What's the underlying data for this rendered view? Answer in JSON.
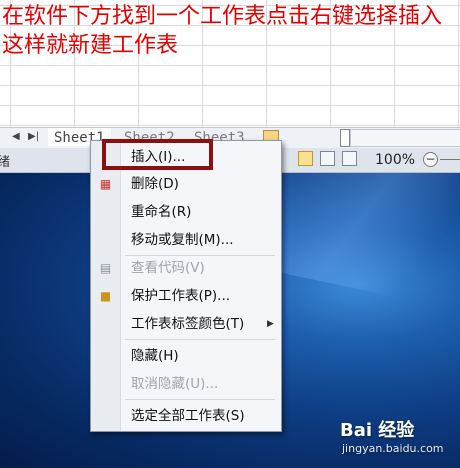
{
  "instruction": {
    "text": "在软件下方找到一个工作表点击右键选择插入这样就新建工作表",
    "color": "#e60000"
  },
  "sheet_tabs": {
    "first_nav_label": "◀",
    "last_nav_label": "▶|",
    "tabs": [
      "Sheet1",
      "Sheet2",
      "Sheet3"
    ],
    "new_sheet_icon": "new-sheet-icon"
  },
  "status_bar": {
    "ready_text": "绪",
    "zoom_text": "100%",
    "zoom_minus_label": "−",
    "view_icons": [
      "normal-view-icon",
      "page-layout-view-icon",
      "page-break-view-icon"
    ]
  },
  "context_menu": {
    "items": [
      {
        "label": "插入(I)...",
        "enabled": true,
        "icon": ""
      },
      {
        "label": "删除(D)",
        "enabled": true,
        "icon": "delete-sheet-icon"
      },
      {
        "label": "重命名(R)",
        "enabled": true,
        "icon": ""
      },
      {
        "label": "移动或复制(M)...",
        "enabled": true,
        "icon": ""
      },
      {
        "label": "查看代码(V)",
        "enabled": false,
        "icon": "view-code-icon"
      },
      {
        "label": "保护工作表(P)...",
        "enabled": true,
        "icon": "lock-icon"
      },
      {
        "label": "工作表标签颜色(T)",
        "enabled": true,
        "icon": "",
        "submenu": true
      },
      {
        "label": "隐藏(H)",
        "enabled": true,
        "icon": ""
      },
      {
        "label": "取消隐藏(U)...",
        "enabled": false,
        "icon": ""
      },
      {
        "label": "选定全部工作表(S)",
        "enabled": true,
        "icon": ""
      }
    ],
    "highlight_color": "#8b1010"
  },
  "watermark": {
    "brand": "Bai 经验",
    "url": "jingyan.baidu.com"
  }
}
